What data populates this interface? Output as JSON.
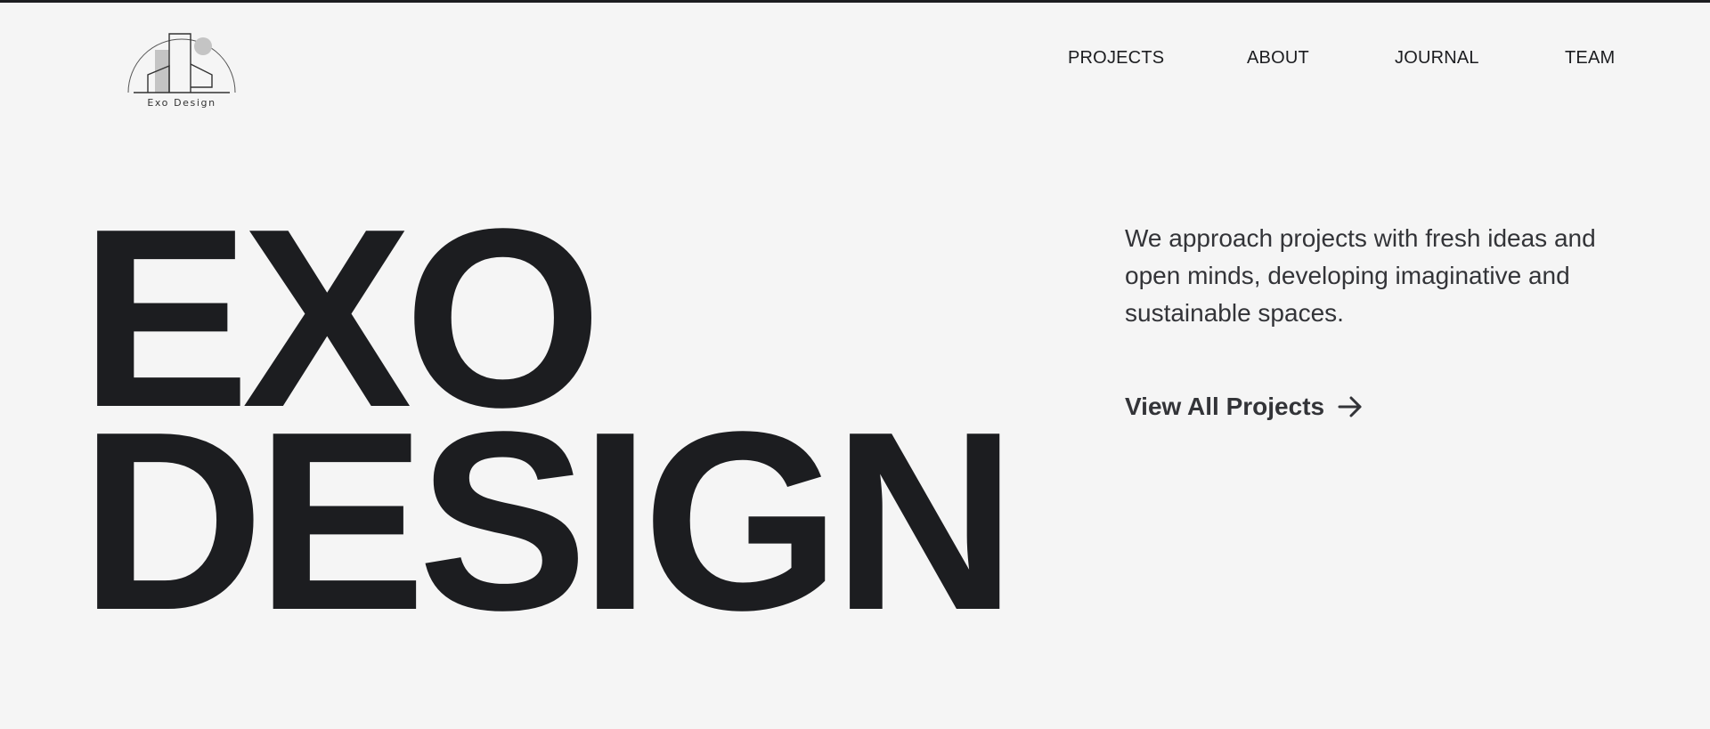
{
  "brand": {
    "logo_text": "Exo Design"
  },
  "nav": {
    "items": [
      {
        "label": "PROJECTS"
      },
      {
        "label": "ABOUT"
      },
      {
        "label": "JOURNAL"
      },
      {
        "label": "TEAM"
      }
    ]
  },
  "hero": {
    "title_line1": "EXO",
    "title_line2": "DESIGN",
    "intro": "We approach projects with fresh ideas and open minds, developing imaginative and sustainable spaces.",
    "cta_label": "View All Projects",
    "cta_icon": "arrow-right-icon"
  },
  "colors": {
    "background": "#f5f5f5",
    "text": "#1c1d20",
    "muted_text": "#333438",
    "logo_fill": "#c4c4c4"
  }
}
